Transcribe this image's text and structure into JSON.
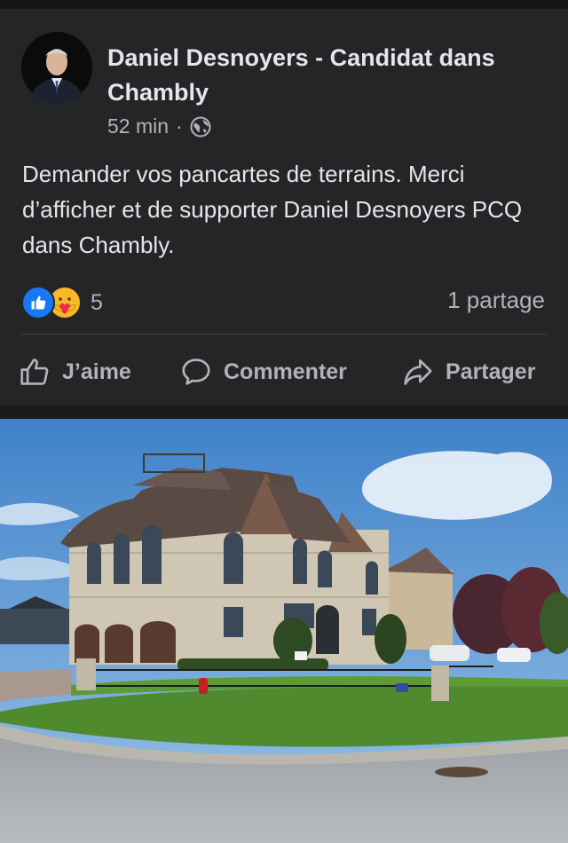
{
  "post": {
    "author": "Daniel Desnoyers - Candidat dans Chambly",
    "time": "52 min",
    "separator": "·",
    "audience_icon": "globe-icon",
    "text": "Demander vos pancartes de terrains. Merci d’afficher et de supporter Daniel Desnoyers PCQ dans Chambly.",
    "reaction_icons": [
      "like-reaction-icon",
      "care-reaction-icon"
    ],
    "reaction_count": "5",
    "shares": "1 partage"
  },
  "actions": {
    "like": "J’aime",
    "comment": "Commenter",
    "share": "Partager"
  },
  "colors": {
    "background": "#18191a",
    "card": "#242526",
    "primary_text": "#e4e6eb",
    "secondary_text": "#b0b3b8",
    "like_blue": "#1877f2",
    "care_yellow": "#f7b928"
  }
}
